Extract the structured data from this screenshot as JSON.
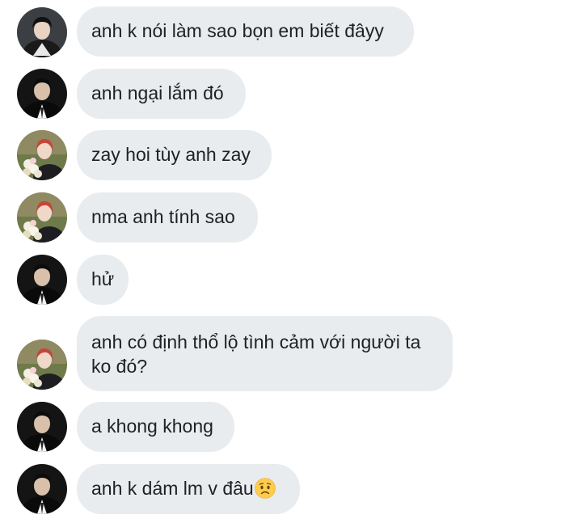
{
  "messages": [
    {
      "sender": "sender-a",
      "text": "anh k nói làm sao bọn em biết đâyy"
    },
    {
      "sender": "sender-b",
      "text": "anh ngại lắm đó"
    },
    {
      "sender": "sender-c",
      "text": "zay hoi tùy anh zay"
    },
    {
      "sender": "sender-c",
      "text": "nma anh tính sao"
    },
    {
      "sender": "sender-b",
      "text": "hử"
    },
    {
      "sender": "sender-c",
      "text": "anh có định thổ lộ tình cảm với người ta ko đó?"
    },
    {
      "sender": "sender-b",
      "text": "a khong khong"
    },
    {
      "sender": "sender-b",
      "text": "anh k dám lm v đâu",
      "emoji": "worried-face-icon"
    }
  ],
  "colors": {
    "bubble_bg": "#e9ecef",
    "text": "#202124",
    "background": "#ffffff"
  }
}
